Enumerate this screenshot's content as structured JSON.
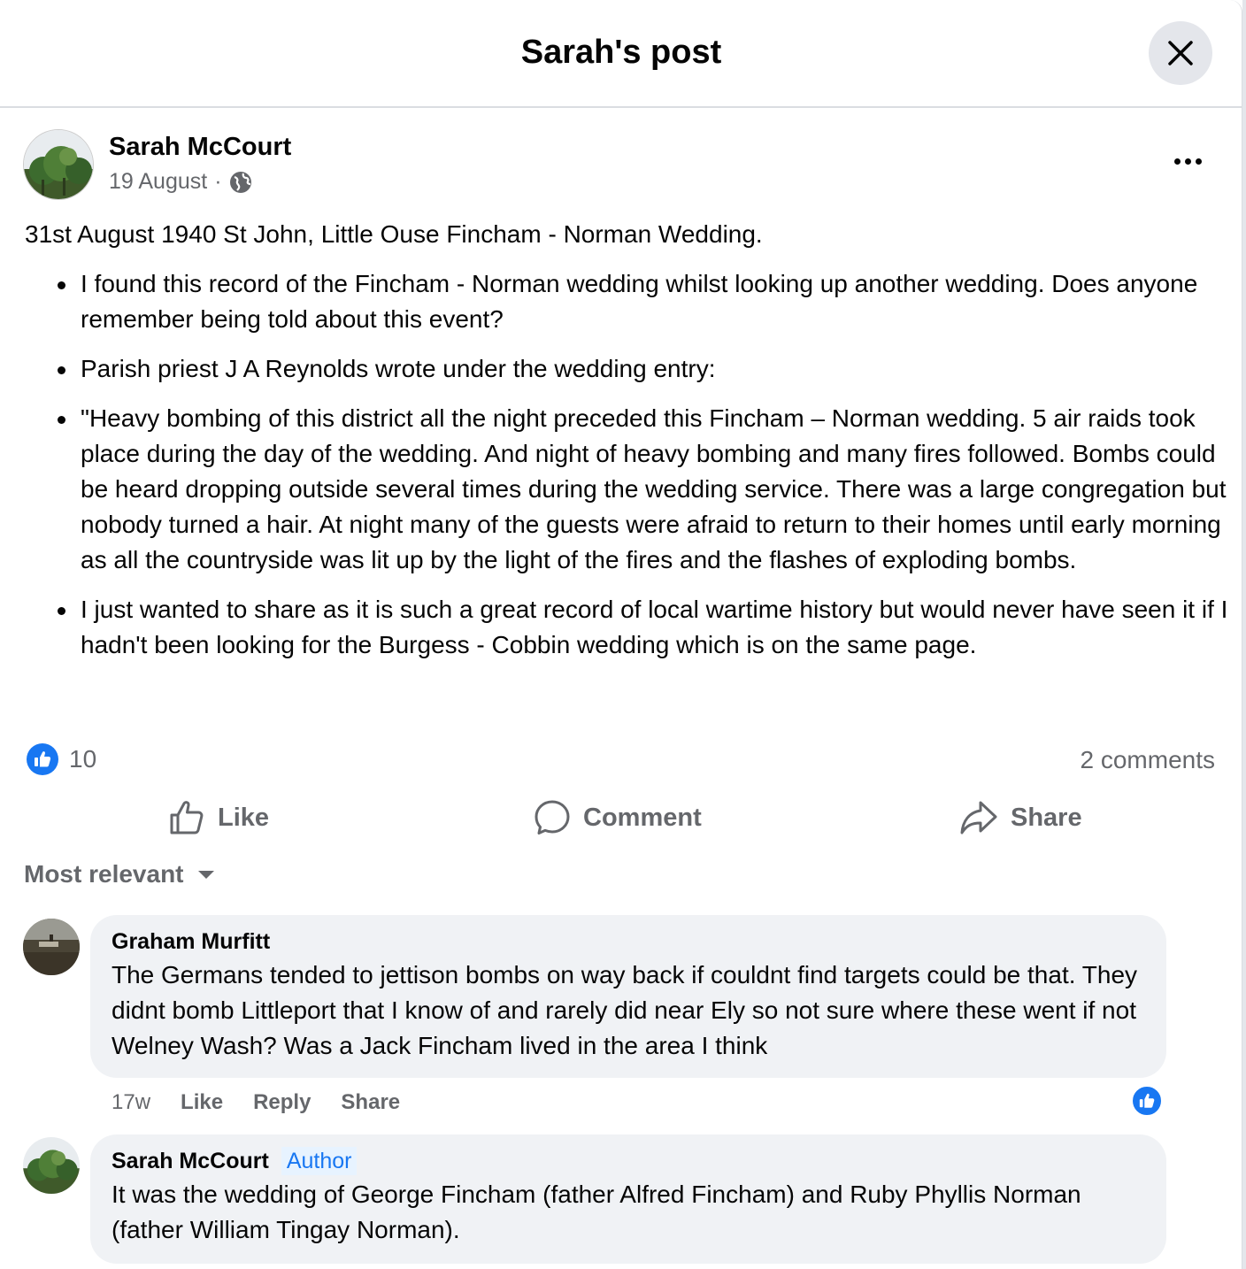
{
  "header": {
    "title": "Sarah's post"
  },
  "post": {
    "author": "Sarah McCourt",
    "date": "19 August",
    "separator": "·",
    "lead": "31st August 1940 St John, Little Ouse Fincham - Norman Wedding.",
    "bullets": [
      "I found this record of the Fincham - Norman wedding whilst looking up another wedding. Does anyone remember being told about this event?",
      "Parish priest J A Reynolds wrote under the wedding entry:",
      "\"Heavy bombing of this district all the night preceded this Fincham – Norman wedding. 5 air raids took place during the day of the wedding. And night of heavy bombing and many fires followed. Bombs could be heard dropping outside several times during the wedding service. There was a large congregation but nobody turned a hair. At night many of the guests were afraid to return to their homes until early morning as all the countryside was lit up by the light of the fires and the flashes of exploding bombs.",
      "I just wanted to share as it is such a great record of local wartime history but would never have seen it if I hadn't been looking for the Burgess - Cobbin wedding which is on the same page."
    ],
    "reaction_count": "10",
    "comments_count": "2 comments"
  },
  "actions": {
    "like": "Like",
    "comment": "Comment",
    "share": "Share"
  },
  "sort": {
    "label": "Most relevant"
  },
  "comments": [
    {
      "name": "Graham Murfitt",
      "text": "The Germans tended to jettison bombs on way back if couldnt find targets could be that. They didnt bomb Littleport that I know of and rarely did near Ely so not sure where these went if not Welney Wash? Was a Jack Fincham lived in the area I think",
      "time": "17w",
      "like": "Like",
      "reply": "Reply",
      "share": "Share"
    },
    {
      "name": "Sarah McCourt",
      "tag": "Author",
      "text": "It was the wedding of George Fincham (father Alfred Fincham) and Ruby Phyllis Norman (father William Tingay Norman)."
    }
  ],
  "colors": {
    "accent": "#1877f2",
    "secondary_text": "#65676b",
    "bubble": "#f0f2f5"
  }
}
